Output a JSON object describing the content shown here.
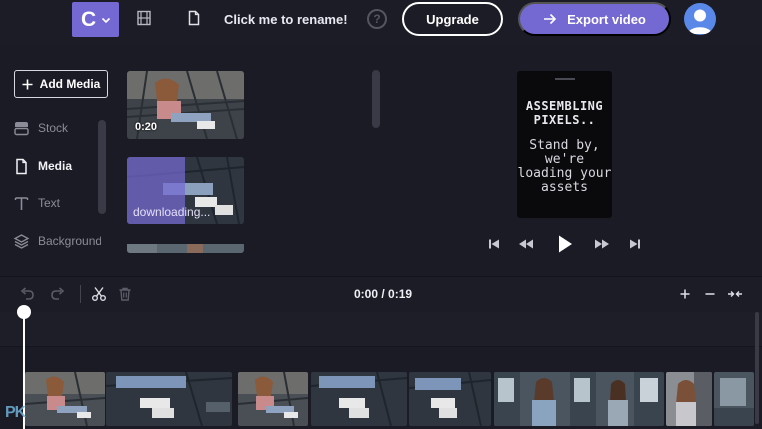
{
  "header": {
    "logo_letter": "C",
    "project_title": "Click me to rename!",
    "help_glyph": "?",
    "upgrade_label": "Upgrade",
    "export_label": "Export video"
  },
  "sidebar": {
    "add_media_label": "Add Media",
    "items": [
      {
        "label": "Stock",
        "icon": "stock-icon",
        "active": false
      },
      {
        "label": "Media",
        "icon": "file-icon",
        "active": true
      },
      {
        "label": "Text",
        "icon": "text-icon",
        "active": false
      },
      {
        "label": "Backgrounds",
        "icon": "layers-icon",
        "active": false
      }
    ]
  },
  "library": {
    "items": [
      {
        "duration": "0:20"
      },
      {
        "status": "downloading..."
      },
      {}
    ]
  },
  "preview": {
    "heading": "ASSEMBLING PIXELS..",
    "body": "Stand by, we're loading your assets"
  },
  "timeline": {
    "timecode": "0:00 / 0:19"
  },
  "watermark": "PK",
  "colors": {
    "accent": "#7469d3",
    "background": "#1b1b25",
    "panel": "#1c1c26"
  }
}
